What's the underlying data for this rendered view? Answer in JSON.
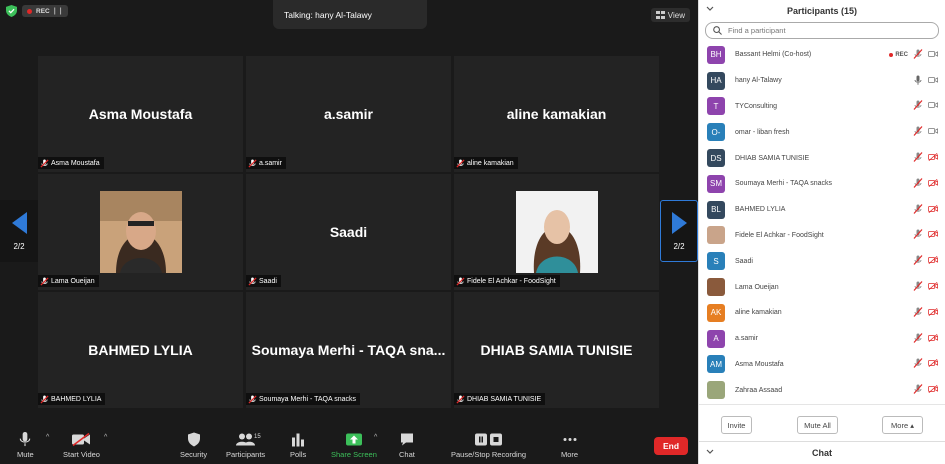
{
  "recording": {
    "label": "REC",
    "controls": "| |"
  },
  "talking": "Talking: hany Al-Talawy",
  "view_button": "View",
  "pager": {
    "label_left": "2/2",
    "label_right": "2/2"
  },
  "tiles": [
    {
      "big_name": "Asma Moustafa",
      "label": "Asma Moustafa",
      "has_photo": false
    },
    {
      "big_name": "a.samir",
      "label": "a.samir",
      "has_photo": false
    },
    {
      "big_name": "aline kamakian",
      "label": "aline kamakian",
      "has_photo": false
    },
    {
      "big_name": "",
      "label": "Lama Oueijan",
      "has_photo": true
    },
    {
      "big_name": "Saadi",
      "label": "Saadi",
      "has_photo": false
    },
    {
      "big_name": "",
      "label": "Fidele El Achkar - FoodSight",
      "has_photo": true
    },
    {
      "big_name": "BAHMED LYLIA",
      "label": "BAHMED LYLIA",
      "has_photo": false
    },
    {
      "big_name": "Soumaya Merhi - TAQA sna...",
      "label": "Soumaya Merhi - TAQA snacks",
      "has_photo": false
    },
    {
      "big_name": "DHIAB SAMIA TUNISIE",
      "label": "DHIAB SAMIA TUNISIE",
      "has_photo": false
    }
  ],
  "toolbar": {
    "mute": "Mute",
    "start_video": "Start Video",
    "security": "Security",
    "participants": "Participants",
    "participants_count": "15",
    "polls": "Polls",
    "share_screen": "Share Screen",
    "chat": "Chat",
    "pause_stop": "Pause/Stop Recording",
    "more": "More",
    "end": "End"
  },
  "panel": {
    "title": "Participants (15)",
    "search_placeholder": "Find a participant",
    "participants": [
      {
        "initials": "BH",
        "name": "Bassant Helmi (Co-host)",
        "color": "#8e44ad",
        "rec": true,
        "mic": "muted",
        "video": "on"
      },
      {
        "initials": "HA",
        "name": "hany Al-Talawy",
        "color": "#34495e",
        "rec": false,
        "mic": "on",
        "video": "on"
      },
      {
        "initials": "T",
        "name": "TYConsulting",
        "color": "#8e44ad",
        "rec": false,
        "mic": "muted",
        "video": "on"
      },
      {
        "initials": "O-",
        "name": "omar - liban fresh",
        "color": "#2980b9",
        "rec": false,
        "mic": "muted",
        "video": "on"
      },
      {
        "initials": "DS",
        "name": "DHIAB SAMIA TUNISIE",
        "color": "#34495e",
        "rec": false,
        "mic": "muted",
        "video": "off"
      },
      {
        "initials": "SM",
        "name": "Soumaya Merhi - TAQA snacks",
        "color": "#8e44ad",
        "rec": false,
        "mic": "muted",
        "video": "off"
      },
      {
        "initials": "BL",
        "name": "BAHMED LYLIA",
        "color": "#34495e",
        "rec": false,
        "mic": "muted",
        "video": "off"
      },
      {
        "initials": "",
        "name": "Fidele El Achkar - FoodSight",
        "color": "#c9a48a",
        "rec": false,
        "mic": "muted",
        "video": "off"
      },
      {
        "initials": "S",
        "name": "Saadi",
        "color": "#2980b9",
        "rec": false,
        "mic": "muted",
        "video": "off"
      },
      {
        "initials": "",
        "name": "Lama Oueijan",
        "color": "#8a5a3c",
        "rec": false,
        "mic": "muted",
        "video": "off"
      },
      {
        "initials": "AK",
        "name": "aline kamakian",
        "color": "#e67e22",
        "rec": false,
        "mic": "muted",
        "video": "off"
      },
      {
        "initials": "A",
        "name": "a.samir",
        "color": "#8e44ad",
        "rec": false,
        "mic": "muted",
        "video": "off"
      },
      {
        "initials": "AM",
        "name": "Asma Moustafa",
        "color": "#2980b9",
        "rec": false,
        "mic": "muted",
        "video": "off"
      },
      {
        "initials": "",
        "name": "Zahraa Assaad",
        "color": "#9aa67a",
        "rec": false,
        "mic": "muted",
        "video": "off"
      }
    ],
    "invite": "Invite",
    "mute_all": "Mute All",
    "more": "More ▴",
    "chat_title": "Chat"
  }
}
